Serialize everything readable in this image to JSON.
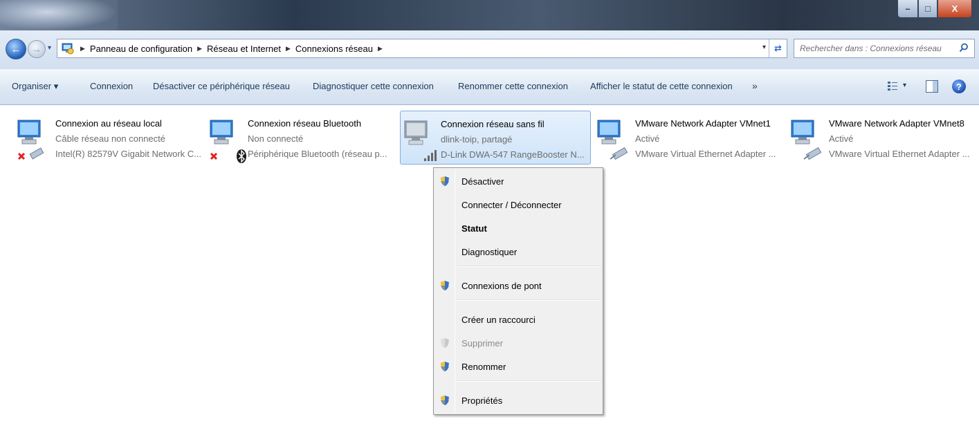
{
  "window": {
    "controls": {
      "minimize": "–",
      "maximize": "□",
      "close": "X"
    }
  },
  "address_bar": {
    "crumbs": [
      "Panneau de configuration",
      "Réseau et Internet",
      "Connexions réseau"
    ],
    "search_placeholder": "Rechercher dans : Connexions réseau"
  },
  "command_bar": {
    "organize": "Organiser ▾",
    "items": [
      "Connexion",
      "Désactiver ce périphérique réseau",
      "Diagnostiquer cette connexion",
      "Renommer cette connexion",
      "Afficher le statut de cette connexion"
    ],
    "more": "»"
  },
  "connections": [
    {
      "name": "Connexion au réseau local",
      "status": "Câble réseau non connecté",
      "device": "Intel(R) 82579V Gigabit Network C...",
      "icon": "wired-disconnected-icon"
    },
    {
      "name": "Connexion réseau Bluetooth",
      "status": "Non connecté",
      "device": "Périphérique Bluetooth (réseau p...",
      "icon": "bluetooth-disconnected-icon"
    },
    {
      "name": "Connexion réseau sans fil",
      "status": "dlink-toip, partagé",
      "device": "D-Link DWA-547 RangeBooster N...",
      "icon": "wireless-signal-icon",
      "selected": true
    },
    {
      "name": "VMware Network Adapter VMnet1",
      "status": "Activé",
      "device": "VMware Virtual Ethernet Adapter ...",
      "icon": "ethernet-adapter-icon"
    },
    {
      "name": "VMware Network Adapter VMnet8",
      "status": "Activé",
      "device": "VMware Virtual Ethernet Adapter ...",
      "icon": "ethernet-adapter-icon"
    }
  ],
  "context_menu": {
    "items": [
      {
        "label": "Désactiver",
        "icon": "uac-shield-icon"
      },
      {
        "label": "Connecter / Déconnecter"
      },
      {
        "label": "Statut",
        "bold": true
      },
      {
        "label": "Diagnostiquer"
      },
      {
        "label": "Connexions de pont",
        "icon": "uac-shield-icon"
      },
      {
        "label": "Créer un raccourci"
      },
      {
        "label": "Supprimer",
        "icon": "uac-shield-disabled-icon",
        "disabled": true
      },
      {
        "label": "Renommer",
        "icon": "uac-shield-icon"
      },
      {
        "label": "Propriétés",
        "icon": "uac-shield-icon"
      }
    ]
  }
}
